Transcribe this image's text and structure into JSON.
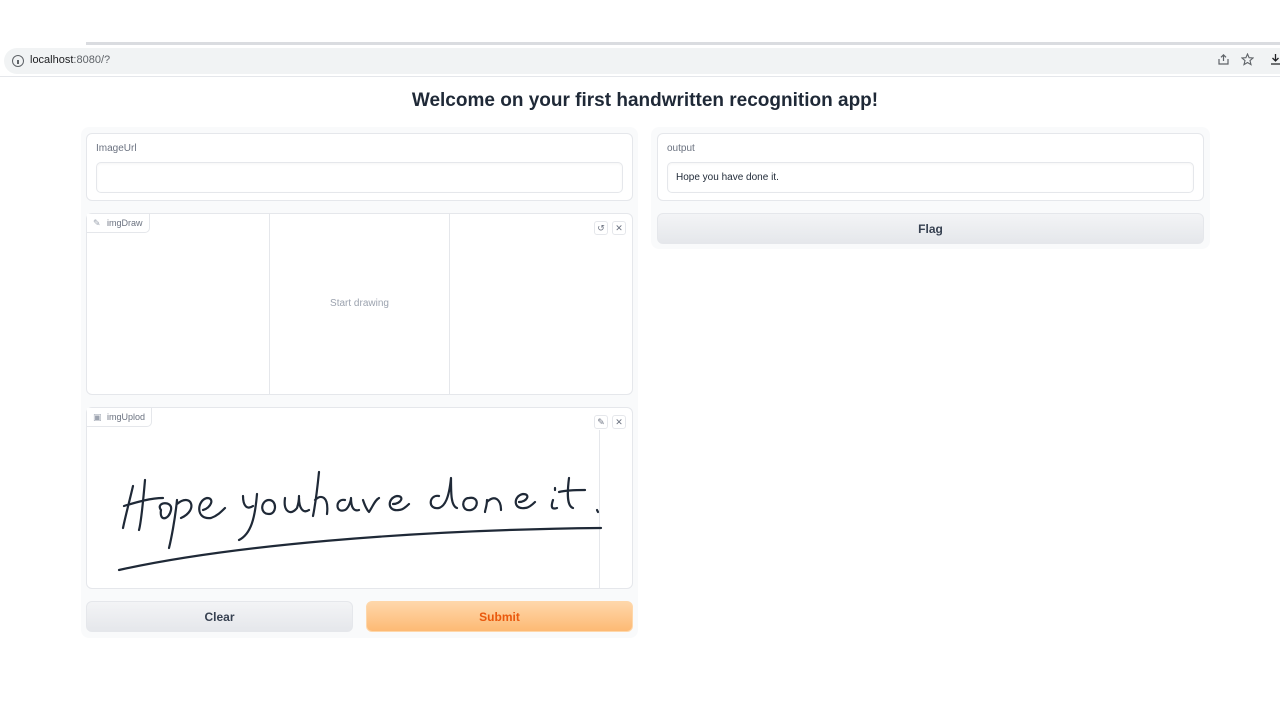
{
  "browser": {
    "url_host": "localhost",
    "url_rest": ":8080/?",
    "icons": [
      "info-icon",
      "share-icon",
      "star-icon",
      "download-icon"
    ]
  },
  "page": {
    "title": "Welcome on your first handwritten recognition app!"
  },
  "inputs": {
    "image_url": {
      "label": "ImageUrl",
      "value": ""
    },
    "img_draw": {
      "label": "imgDraw",
      "placeholder": "Start drawing"
    },
    "img_upload": {
      "label": "imgUplod",
      "handwriting": "Hope you have done it."
    }
  },
  "actions": {
    "clear_label": "Clear",
    "submit_label": "Submit"
  },
  "outputs": {
    "output": {
      "label": "output",
      "value": "Hope you have done it."
    },
    "flag_label": "Flag"
  },
  "colors": {
    "accent": "#ea580c",
    "primary_button": "#fdba74",
    "border": "#e5e7eb"
  }
}
